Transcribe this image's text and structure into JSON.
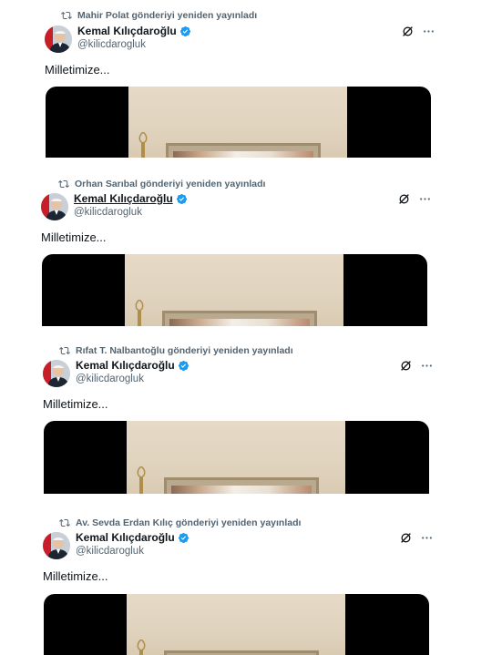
{
  "posts": [
    {
      "reposted_by": "Mahir Polat gönderiyi yeniden yayınladı",
      "author_name": "Kemal Kılıçdaroğlu",
      "author_handle": "@kilicdarogluk",
      "text": "Milletimize...",
      "name_underlined": false
    },
    {
      "reposted_by": "Orhan Sarıbal gönderiyi yeniden yayınladı",
      "author_name": "Kemal Kılıçdaroğlu",
      "author_handle": "@kilicdarogluk",
      "text": "Milletimize...",
      "name_underlined": true
    },
    {
      "reposted_by": "Rıfat T. Nalbantoğlu gönderiyi yeniden yayınladı",
      "author_name": "Kemal Kılıçdaroğlu",
      "author_handle": "@kilicdarogluk",
      "text": "Milletimize...",
      "name_underlined": false
    },
    {
      "reposted_by": "Av. Sevda Erdan Kılıç gönderiyi yeniden yayınladı",
      "author_name": "Kemal Kılıçdaroğlu",
      "author_handle": "@kilicdarogluk",
      "text": "Milletimize...",
      "name_underlined": false
    }
  ],
  "icons": {
    "repost": "repost-icon",
    "verified": "verified-badge-icon",
    "grok": "grok-icon",
    "more": "more-icon"
  },
  "colors": {
    "verified": "#1d9bf0",
    "secondary_text": "#536471",
    "primary_text": "#0f1419"
  }
}
